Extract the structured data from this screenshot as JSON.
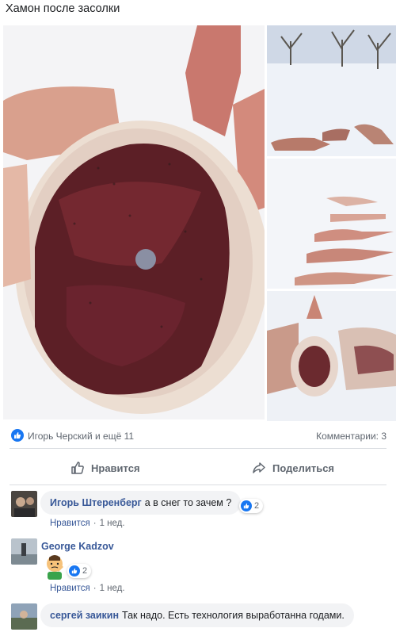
{
  "post": {
    "text": "Хамон после засолки"
  },
  "gallery": {
    "photos": [
      {
        "name": "cured ham close-up"
      },
      {
        "name": "hams on snow in orchard"
      },
      {
        "name": "hams in a row on snow"
      },
      {
        "name": "salted hams on snow"
      }
    ]
  },
  "reactions": {
    "icon": "like-icon",
    "people": "Игорь Черский и ещё 11",
    "comments": "Комментарии: 3"
  },
  "actions": {
    "like_label": "Нравится",
    "share_label": "Поделиться"
  },
  "comments": [
    {
      "author": "Игорь Штеренберг",
      "text": "а в снег то зачем ?",
      "reaction_count": "2",
      "like_label": "Нравится",
      "time": "1 нед."
    },
    {
      "author": "George Kadzov",
      "sticker": "thinking-face-sticker",
      "reaction_count": "2",
      "like_label": "Нравится",
      "time": "1 нед."
    },
    {
      "author": "сергей заикин",
      "text": "Так надо. Есть технология выработанна годами."
    }
  ],
  "colors": {
    "accent": "#1877f2",
    "link": "#385898",
    "muted": "#606770",
    "bubble": "#f2f3f5"
  }
}
